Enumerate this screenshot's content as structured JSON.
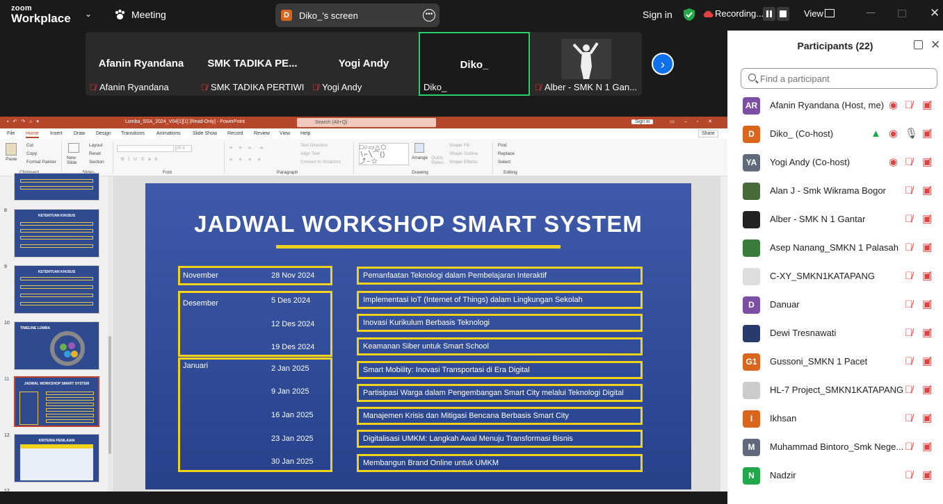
{
  "topbar": {
    "logo_top": "zoom",
    "logo_bottom": "Workplace",
    "meeting_label": "Meeting",
    "screen_owner_initial": "D",
    "screen_label": "Diko_'s screen",
    "signin": "Sign in",
    "recording": "Recording...",
    "view": "View"
  },
  "strip": {
    "tiles": [
      {
        "name": "Afanin Ryandana",
        "label": "Afanin Ryandana",
        "muted": true
      },
      {
        "name": "SMK TADIKA PE...",
        "label": "SMK TADIKA PERTIWI",
        "muted": true
      },
      {
        "name": "Yogi Andy",
        "label": "Yogi Andy",
        "muted": true
      },
      {
        "name": "Diko_",
        "label": "Diko_",
        "muted": false
      },
      {
        "name": "",
        "label": "Alber - SMK N 1 Gan...",
        "muted": true
      }
    ]
  },
  "ppt": {
    "filename": "Lomba_SSA_2024_V04[1][1] [Read-Only] - PowerPoint",
    "search": "Search (Alt+Q)",
    "signin": "Sign in",
    "menu": [
      "File",
      "Home",
      "Insert",
      "Draw",
      "Design",
      "Transitions",
      "Animations",
      "Slide Show",
      "Record",
      "Review",
      "View",
      "Help"
    ],
    "share": "Share",
    "ribbon": {
      "paste": "Paste",
      "cut": "Cut",
      "copy": "Copy",
      "format_painter": "Format Painter",
      "clipboard": "Clipboard",
      "new_slide": "New Slide",
      "layout": "Layout",
      "reset": "Reset",
      "section": "Section",
      "slides": "Slides",
      "font": "Font",
      "font_size": "25.4",
      "text_direction": "Text Direction",
      "align_text": "Align Text",
      "convert": "Convert to SmartArt",
      "paragraph": "Paragraph",
      "arrange": "Arrange",
      "quick_styles": "Quick Styles",
      "shape_fill": "Shape Fill",
      "shape_outline": "Shape Outline",
      "shape_effects": "Shape Effects",
      "drawing": "Drawing",
      "find": "Find",
      "replace": "Replace",
      "select": "Select",
      "editing": "Editing"
    },
    "thumbs": [
      {
        "num": "8",
        "title": "KETENTUAN KHUSUS"
      },
      {
        "num": "9",
        "title": "KETENTUAN KHUSUS"
      },
      {
        "num": "10",
        "title": "TIMELINE LOMBA"
      },
      {
        "num": "11",
        "title": "JADWAL WORKSHOP SMART SYSTEM"
      },
      {
        "num": "12",
        "title": "KRITERIA PENILAIAN"
      }
    ]
  },
  "slide": {
    "title": "JADWAL WORKSHOP SMART SYSTEM",
    "months": [
      {
        "month": "November",
        "dates": [
          "28 Nov 2024"
        ]
      },
      {
        "month": "Desember",
        "dates": [
          "5 Des 2024",
          "12 Des 2024",
          "19 Des 2024"
        ]
      },
      {
        "month": "Januari",
        "dates": [
          "2 Jan 2025",
          "9 Jan 2025",
          "16 Jan 2025",
          "23 Jan 2025",
          "30 Jan 2025"
        ]
      }
    ],
    "topics": [
      "Pemanfaatan Teknologi dalam Pembelajaran Interaktif",
      "Implementasi IoT (Internet of Things) dalam Lingkungan Sekolah",
      "Inovasi Kurikulum Berbasis Teknologi",
      "Keamanan Siber untuk Smart School",
      "Smart Mobility: Inovasi Transportasi di Era Digital",
      "Partisipasi Warga dalam Pengembangan Smart City melalui Teknologi Digital",
      "Manajemen Krisis dan Mitigasi Bencana Berbasis Smart City",
      "Digitalisasi UMKM: Langkah Awal Menuju Transformasi Bisnis",
      "Membangun Brand Online untuk UMKM"
    ]
  },
  "panel": {
    "title": "Participants (22)",
    "search_placeholder": "Find a participant",
    "participants": [
      {
        "initials": "AR",
        "color": "#7b4fa3",
        "name": "Afanin Ryandana (Host, me)"
      },
      {
        "initials": "D",
        "color": "#d9661c",
        "name": "Diko_ (Co-host)"
      },
      {
        "initials": "YA",
        "color": "#5f6b7a",
        "name": "Yogi Andy (Co-host)"
      },
      {
        "initials": "",
        "color": "#4a6a3a",
        "name": "Alan J - Smk Wikrama Bogor"
      },
      {
        "initials": "",
        "color": "#222222",
        "name": "Alber - SMK N 1 Gantar"
      },
      {
        "initials": "",
        "color": "#3a7a3a",
        "name": "Asep Nanang_SMKN 1 Palasah"
      },
      {
        "initials": "",
        "color": "#dddddd",
        "name": "C-XY_SMKN1KATAPANG"
      },
      {
        "initials": "D",
        "color": "#7b4fa3",
        "name": "Danuar"
      },
      {
        "initials": "",
        "color": "#2a3a6a",
        "name": "Dewi Tresnawati"
      },
      {
        "initials": "G1",
        "color": "#d9661c",
        "name": "Gussoni_SMKN 1 Pacet"
      },
      {
        "initials": "",
        "color": "#cccccc",
        "name": "HL-7 Project_SMKN1KATAPANG"
      },
      {
        "initials": "I",
        "color": "#d9661c",
        "name": "Ikhsan"
      },
      {
        "initials": "M",
        "color": "#5f6b7a",
        "name": "Muhammad Bintoro_Smk Nege..."
      },
      {
        "initials": "N",
        "color": "#22a84a",
        "name": "Nadzir"
      }
    ]
  }
}
